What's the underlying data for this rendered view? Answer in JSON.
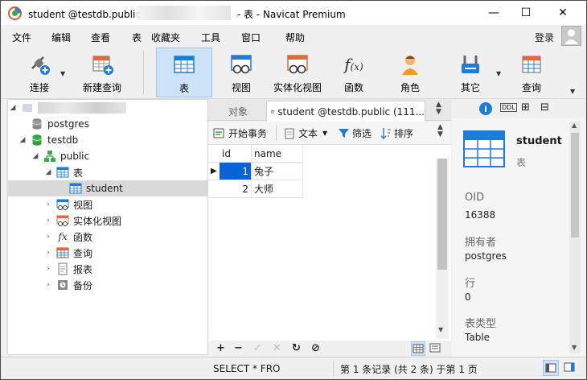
{
  "window": {
    "title_prefix": "student @testdb.public",
    "title_suffix": "- 表 - Navicat Premium"
  },
  "menu": {
    "items": [
      "文件",
      "编辑",
      "查看",
      "表",
      "收藏夹",
      "工具",
      "窗口",
      "帮助"
    ],
    "login": "登录"
  },
  "toolbar": {
    "connect": "连接",
    "new_query": "新建查询",
    "table": "表",
    "view": "视图",
    "materialized_view": "实体化视图",
    "function": "函数",
    "role": "角色",
    "other": "其它",
    "query": "查询"
  },
  "tree": {
    "postgres": "postgres",
    "testdb": "testdb",
    "public": "public",
    "tables": "表",
    "student": "student",
    "views": "视图",
    "mat_views": "实体化视图",
    "functions": "函数",
    "queries": "查询",
    "reports": "报表",
    "backups": "备份"
  },
  "tabs": {
    "objects": "对象",
    "current": "student @testdb.public (111..."
  },
  "grid_toolbar": {
    "begin_tx": "开始事务",
    "text": "文本",
    "filter": "筛选",
    "sort": "排序"
  },
  "grid": {
    "columns": [
      "id",
      "name"
    ],
    "rows": [
      {
        "id": "1",
        "name": "兔子"
      },
      {
        "id": "2",
        "name": "大师"
      }
    ]
  },
  "info": {
    "name": "student",
    "type": "表",
    "oid_label": "OID",
    "oid": "16388",
    "owner_label": "拥有者",
    "owner": "postgres",
    "rows_label": "行",
    "rows": "0",
    "table_type_label": "表类型",
    "table_type": "Table"
  },
  "status": {
    "sql": "SELECT * FRO",
    "record": "第 1 条记录 (共 2 条) 于第 1 页"
  },
  "colors": {
    "accent": "#1f7bd8",
    "selection": "#0a64d8",
    "tool_active": "#cde3f7"
  }
}
